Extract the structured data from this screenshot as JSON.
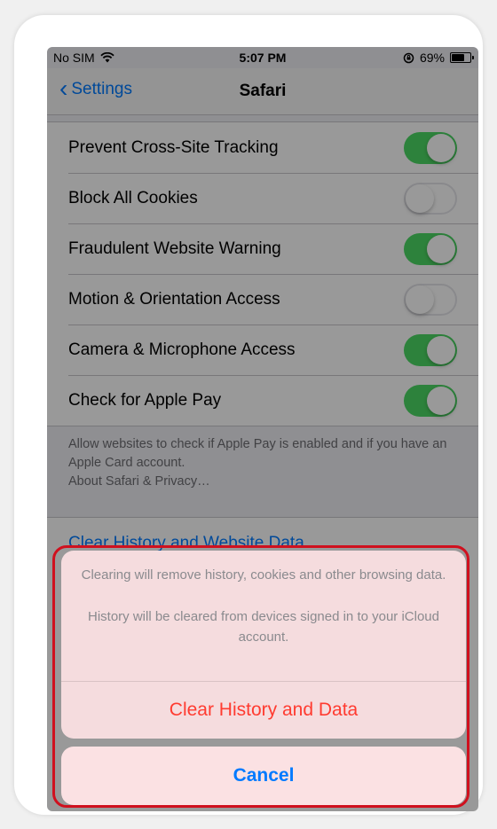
{
  "status_bar": {
    "carrier": "No SIM",
    "time": "5:07 PM",
    "battery_percent": "69%",
    "battery_level": 0.69
  },
  "nav": {
    "back_label": "Settings",
    "title": "Safari"
  },
  "settings": {
    "rows": [
      {
        "label": "Prevent Cross-Site Tracking",
        "on": true
      },
      {
        "label": "Block All Cookies",
        "on": false
      },
      {
        "label": "Fraudulent Website Warning",
        "on": true
      },
      {
        "label": "Motion & Orientation Access",
        "on": false
      },
      {
        "label": "Camera & Microphone Access",
        "on": true
      },
      {
        "label": "Check for Apple Pay",
        "on": true
      }
    ],
    "footer_note": "Allow websites to check if Apple Pay is enabled and if you have an Apple Card account.",
    "footer_link": "About Safari & Privacy…",
    "clear_link": "Clear History and Website Data"
  },
  "action_sheet": {
    "message_1": "Clearing will remove history, cookies and other browsing data.",
    "message_2": "History will be cleared from devices signed in to your iCloud account.",
    "action_label": "Clear History and Data",
    "cancel_label": "Cancel"
  },
  "colors": {
    "accent": "#007aff",
    "destructive": "#ff3b30",
    "toggle_on": "#4cd964",
    "highlight_border": "#d0101e"
  }
}
